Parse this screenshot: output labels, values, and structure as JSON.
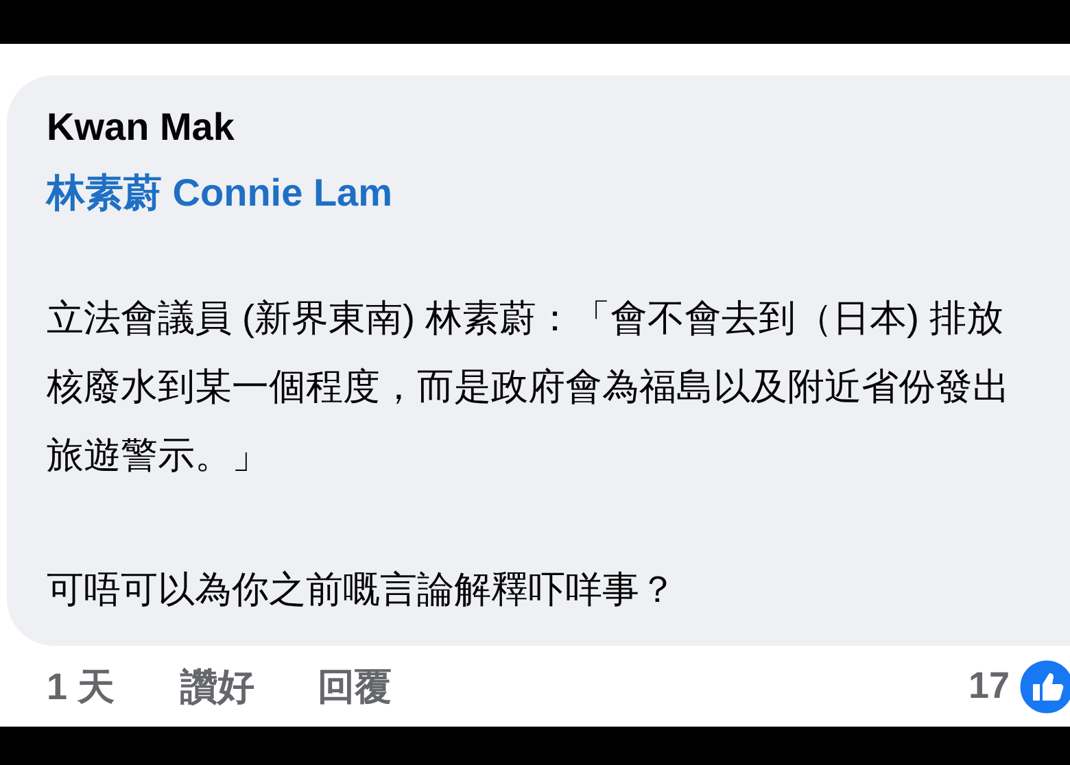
{
  "comment": {
    "author": "Kwan Mak",
    "tag": "林素蔚 Connie Lam",
    "paragraphs": [
      "立法會議員 (新界東南) 林素蔚：「會不會去到（日本) 排放核廢水到某一個程度，而是政府會為福島以及附近省份發出旅遊警示。」",
      "可唔可以為你之前嘅言論解釋吓咩事？"
    ]
  },
  "footer": {
    "time": "1 天",
    "actions": [
      "讚好",
      "回覆"
    ],
    "reaction_count": "17"
  }
}
